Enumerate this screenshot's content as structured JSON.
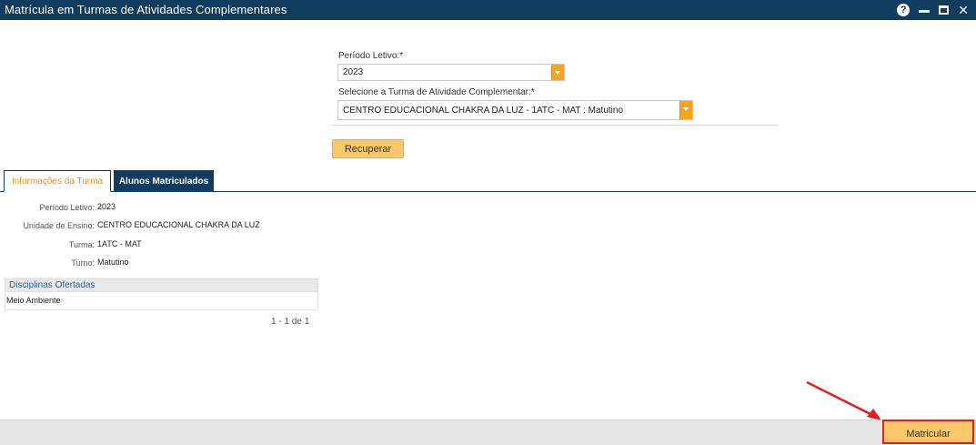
{
  "window": {
    "title": "Matrícula em Turmas de Atividades Complementares",
    "help_glyph": "?",
    "close_glyph": "✕"
  },
  "form": {
    "periodo_label": "Período Letivo:*",
    "periodo_value": "2023",
    "turma_label": "Selecione a Turma de Atividade Complementar:*",
    "turma_value": "CENTRO EDUCACIONAL CHAKRA DA LUZ - 1ATC - MAT : Matutino",
    "recuperar_label": "Recuperar"
  },
  "tabs": [
    {
      "label": "Informações da Turma",
      "active": true
    },
    {
      "label": "Alunos Matriculados",
      "active": false
    }
  ],
  "info": {
    "periodo_label": "Período Letivo:",
    "periodo_value": "2023",
    "unidade_label": "Unidade de Ensino:",
    "unidade_value": "CENTRO EDUCACIONAL CHAKRA DA LUZ",
    "turma_label": "Turma:",
    "turma_value": "1ATC - MAT",
    "turno_label": "Turno:",
    "turno_value": "Matutino"
  },
  "grid": {
    "header": "Disciplinas Ofertadas",
    "rows": [
      "Meio Ambiente"
    ],
    "pager": "1 - 1 de 1"
  },
  "footer": {
    "matricular_label": "Matricular"
  },
  "colors": {
    "titlebar": "#0f3c5f",
    "accent": "#fbc76b",
    "highlight": "#e02020"
  }
}
